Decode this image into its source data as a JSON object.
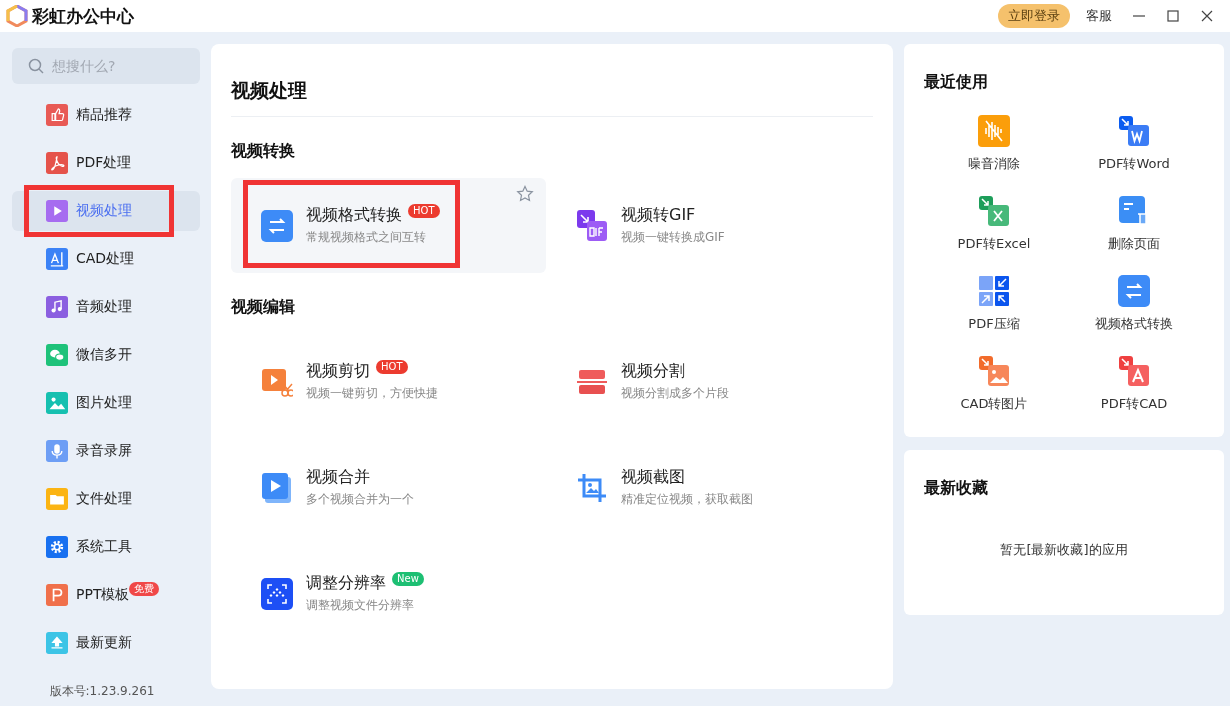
{
  "window": {
    "title": "彩虹办公中心",
    "login_button": "立即登录",
    "service_link": "客服"
  },
  "search": {
    "placeholder": "想搜什么?"
  },
  "sidebar": {
    "items": [
      {
        "label": "精品推荐",
        "selected": false,
        "highlighted": false
      },
      {
        "label": "PDF处理",
        "selected": false,
        "highlighted": false
      },
      {
        "label": "视频处理",
        "selected": true,
        "highlighted": true
      },
      {
        "label": "CAD处理",
        "selected": false,
        "highlighted": false
      },
      {
        "label": "音频处理",
        "selected": false,
        "highlighted": false
      },
      {
        "label": "微信多开",
        "selected": false,
        "highlighted": false
      },
      {
        "label": "图片处理",
        "selected": false,
        "highlighted": false
      },
      {
        "label": "录音录屏",
        "selected": false,
        "highlighted": false
      },
      {
        "label": "文件处理",
        "selected": false,
        "highlighted": false
      },
      {
        "label": "系统工具",
        "selected": false,
        "highlighted": false
      },
      {
        "label": "PPT模板",
        "selected": false,
        "highlighted": false,
        "badge": {
          "text": "免费",
          "color": "#f04848"
        }
      },
      {
        "label": "最新更新",
        "selected": false,
        "highlighted": false
      }
    ],
    "version": "版本号:1.23.9.261"
  },
  "main": {
    "title": "视频处理",
    "sections": [
      {
        "title": "视频转换",
        "tools": [
          {
            "name": "视频格式转换",
            "description": "常规视频格式之间互转",
            "hovered": true,
            "highlighted": true,
            "badge": {
              "text": "HOT",
              "color": "#ec3b2f"
            }
          },
          {
            "name": "视频转GIF",
            "description": "视频一键转换成GIF",
            "hovered": false,
            "highlighted": false
          }
        ]
      },
      {
        "title": "视频编辑",
        "tools": [
          {
            "name": "视频剪切",
            "description": "视频一键剪切，方便快捷",
            "hovered": false,
            "highlighted": false,
            "badge": {
              "text": "HOT",
              "color": "#ec3b2f"
            }
          },
          {
            "name": "视频分割",
            "description": "视频分割成多个片段",
            "hovered": false,
            "highlighted": false
          },
          {
            "name": "视频合并",
            "description": "多个视频合并为一个",
            "hovered": false,
            "highlighted": false
          },
          {
            "name": "视频截图",
            "description": "精准定位视频，获取截图",
            "hovered": false,
            "highlighted": false
          },
          {
            "name": "调整分辨率",
            "description": "调整视频文件分辨率",
            "hovered": false,
            "highlighted": false,
            "badge": {
              "text": "New",
              "color": "#1dbf73"
            }
          }
        ]
      }
    ]
  },
  "recent": {
    "title": "最近使用",
    "items": [
      {
        "label": "噪音消除"
      },
      {
        "label": "PDF转Word"
      },
      {
        "label": "PDF转Excel"
      },
      {
        "label": "删除页面"
      },
      {
        "label": "PDF压缩"
      },
      {
        "label": "视频格式转换"
      },
      {
        "label": "CAD转图片"
      },
      {
        "label": "PDF转CAD"
      }
    ]
  },
  "favorites": {
    "title": "最新收藏",
    "empty_text": "暂无[最新收藏]的应用"
  }
}
